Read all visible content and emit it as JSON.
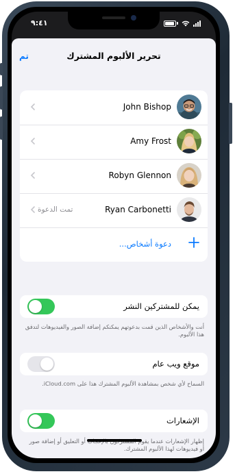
{
  "status_bar": {
    "time": "٩:٤١"
  },
  "nav": {
    "title": "تحرير الألبوم المشترك",
    "done_label": "تم"
  },
  "members": [
    {
      "name": "John Bishop",
      "status": ""
    },
    {
      "name": "Amy Frost",
      "status": ""
    },
    {
      "name": "Robyn Glennon",
      "status": ""
    },
    {
      "name": "Ryan Carbonetti",
      "status": "تمت الدعوة"
    }
  ],
  "invite": {
    "label": "دعوة أشخاص..."
  },
  "settings": {
    "subscribers_post": {
      "label": "يمكن للمشتركين النشر",
      "on": true,
      "footnote": "أنت والأشخاص الذين قمت بدعوتهم يمكنكم إضافة الصور والفيديوهات لتدفق هذا الألبوم."
    },
    "public_website": {
      "label": "موقع ويب عام",
      "on": false,
      "footnote": "السماح لأي شخص بمشاهدة الألبوم المشترك هذا على iCloud.com."
    },
    "notifications": {
      "label": "الإشعارات",
      "on": true,
      "footnote": "إظهار الإشعارات عندما يقوم المشتركون بالإعجاب أو التعليق أو إضافة صور أو فيديوهات لهذا الألبوم المشترك."
    }
  },
  "colors": {
    "accent": "#0a7aff",
    "toggle_on": "#34c759",
    "toggle_off": "#e5e5ea"
  }
}
